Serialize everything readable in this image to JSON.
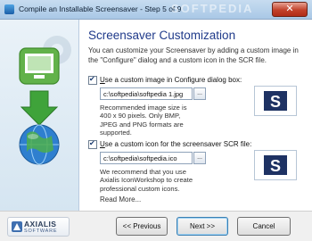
{
  "window": {
    "title": "Compile an Installable Screensaver - Step 5 of 9",
    "watermark": "SOFTPEDIA",
    "close_label": "✕"
  },
  "page": {
    "heading": "Screensaver Customization",
    "intro": "You can customize your Screensaver by adding a custom image in the \"Configure\" dialog and a custom icon in the SCR file."
  },
  "configure_image": {
    "checked": true,
    "label_prefix": "",
    "label_hotkey": "U",
    "label_rest": "se a custom image in Configure dialog box:",
    "path": "c:\\softpedia\\softpedia 1.jpg",
    "browse_label": "...",
    "note": "Recommended image size is 400 x 90 pixels. Only BMP, JPEG and PNG formats are supported.",
    "preview_letter": "S"
  },
  "scr_icon": {
    "checked": true,
    "label_prefix": "",
    "label_hotkey": "U",
    "label_rest": "se a custom icon for the screensaver SCR file:",
    "path": "c:\\softpedia\\softpedia.ico",
    "browse_label": "...",
    "note": "We recommend that you use Axialis IconWorkshop to create professional custom icons.",
    "preview_letter": "S",
    "read_more": "Read More..."
  },
  "branding": {
    "logo_name": "AXIALIS",
    "logo_sub": "SOFTWARE"
  },
  "buttons": {
    "previous": "<< Previous",
    "next": "Next >>",
    "cancel": "Cancel"
  },
  "colors": {
    "heading": "#1f3a8a",
    "preview_bg": "#1e3263"
  },
  "icons": {
    "app": "app-icon",
    "monitor": "monitor-icon",
    "download_arrow": "download-arrow-icon",
    "globe": "globe-icon",
    "axialis_logo": "axialis-logo-icon"
  }
}
